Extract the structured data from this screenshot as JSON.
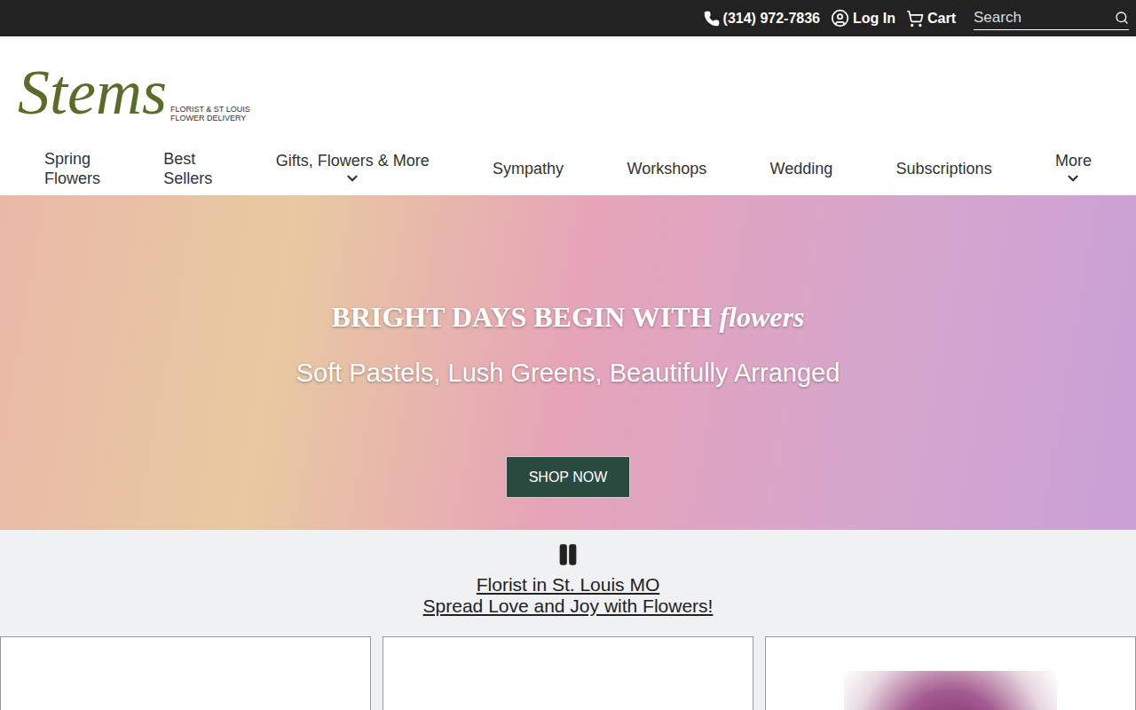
{
  "top_bar": {
    "phone": "(314) 972-7836",
    "login": "Log In",
    "cart": "Cart",
    "search": {
      "placeholder": "Search"
    }
  },
  "logo": {
    "name": "Stems",
    "tagline": [
      "FLORIST & ST LOUIS",
      "FLOWER DELIVERY"
    ]
  },
  "nav": [
    {
      "label": "Spring Flowers",
      "dropdown": false
    },
    {
      "label": "Best Sellers",
      "dropdown": false
    },
    {
      "label": "Gifts, Flowers & More",
      "dropdown": true
    },
    {
      "label": "Sympathy",
      "dropdown": false
    },
    {
      "label": "Workshops",
      "dropdown": false
    },
    {
      "label": "Wedding",
      "dropdown": false
    },
    {
      "label": "Subscriptions",
      "dropdown": false
    },
    {
      "label": "More",
      "dropdown": true
    }
  ],
  "hero": {
    "title": "BRIGHT DAYS BEGIN WITH ",
    "title_emphasis": "flowers",
    "subtitle": "Soft Pastels, Lush Greens, Beautifully Arranged",
    "button": "SHOP NOW"
  },
  "intro": {
    "links": [
      "Florist in St. Louis MO",
      "Spread Love and Joy with Flowers!"
    ]
  },
  "products": [
    {
      "image_loaded": false
    },
    {
      "image_loaded": false
    },
    {
      "image_loaded": true
    }
  ]
}
